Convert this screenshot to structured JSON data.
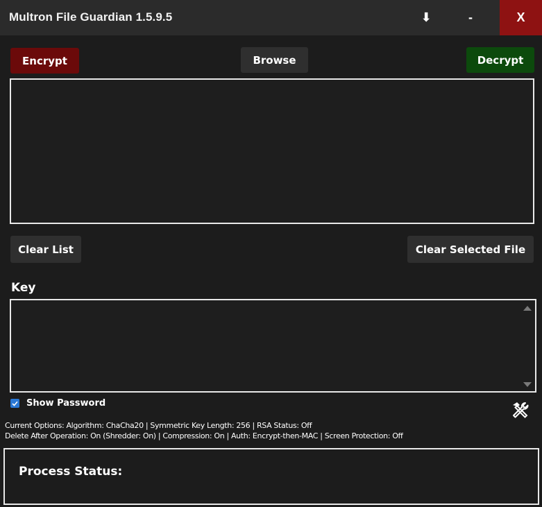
{
  "window": {
    "title": "Multron File Guardian 1.5.9.5",
    "download_glyph": "⬇",
    "minimize_glyph": "-",
    "close_glyph": "X"
  },
  "actions": {
    "encrypt_label": "Encrypt",
    "browse_label": "Browse",
    "decrypt_label": "Decrypt",
    "clear_list_label": "Clear List",
    "clear_selected_label": "Clear Selected File"
  },
  "file_list": {
    "items": []
  },
  "key": {
    "label": "Key",
    "value": ""
  },
  "show_password": {
    "label": "Show Password",
    "checked": true
  },
  "tools": {
    "icon": "tools-icon"
  },
  "options": {
    "line1": "Current Options: Algorithm: ChaCha20 | Symmetric Key Length: 256 | RSA Status: Off",
    "line2": "Delete After Operation: On (Shredder: On) | Compression: On | Auth: Encrypt-then-MAC | Screen Protection: Off"
  },
  "status": {
    "label": "Process Status:"
  },
  "colors": {
    "background": "#1c1c1c",
    "titlebar": "#2b2b2b",
    "close": "#8e1212",
    "encrypt": "#6b0a0a",
    "decrypt": "#0c4a0c",
    "neutral_button": "#2f2f2f",
    "checkbox": "#2a78d6"
  }
}
